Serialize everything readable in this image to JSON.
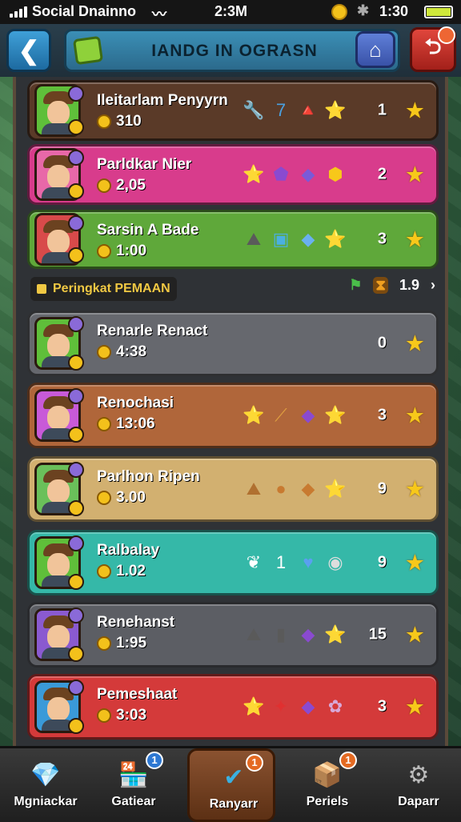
{
  "status_bar": {
    "carrier": "Social Dnainno",
    "time": "2:3M",
    "time_right": "1:30",
    "icons": [
      "signal-icon",
      "wifi-icon",
      "coin-icon",
      "bluetooth-icon",
      "battery-icon"
    ]
  },
  "header": {
    "title": "IANDG IN OGRASN",
    "back_icon": "back-chevron-icon",
    "title_icon": "gem-icon",
    "home_icon": "home-icon",
    "exit_icon": "exit-icon"
  },
  "top_rows": [
    {
      "name": "Ileitarlam Penyyrn",
      "score": "310",
      "rank": "1",
      "color": "#5a3a28",
      "avatar_bg": "#5fbf3a",
      "items": [
        "🔧",
        "7",
        "🔺",
        "⭐"
      ],
      "item_colors": [
        "#6a7a8a",
        "#4aa0e0",
        "#e23838",
        "#f7c81a"
      ]
    },
    {
      "name": "Parldkar Nier",
      "score": "2,05",
      "rank": "2",
      "color": "#d83c8c",
      "avatar_bg": "#e868a8",
      "items": [
        "⭐",
        "⬟",
        "◆",
        "⬢"
      ],
      "item_colors": [
        "#f7c81a",
        "#8a4ad0",
        "#7a5ad8",
        "#f7c81a"
      ]
    },
    {
      "name": "Sarsin A Bade",
      "score": "1:00",
      "rank": "3",
      "color": "#5fa83a",
      "avatar_bg": "#d84a4a",
      "items": [
        "⛰",
        "▣",
        "◆",
        "⭐"
      ],
      "item_colors": [
        "#5a5a5a",
        "#4ab0e0",
        "#6ab0f0",
        "#f7c81a"
      ]
    }
  ],
  "section": {
    "label": "Peringkat PEMAAN",
    "page": "1.9",
    "icons": [
      "flag-icon",
      "hourglass-icon",
      "chevron-right-icon"
    ]
  },
  "rows": [
    {
      "name": "Renarle Renact",
      "score": "4:38",
      "rank": "0",
      "color": "#66686e",
      "avatar_bg": "#5fbf3a",
      "items": [],
      "item_colors": []
    },
    {
      "name": "Renochasi",
      "score": "13:06",
      "rank": "3",
      "color": "#b0663a",
      "avatar_bg": "#c85ad8",
      "items": [
        "⭐",
        "⟋",
        "◆",
        "⭐"
      ],
      "item_colors": [
        "#f7c81a",
        "#e0a040",
        "#8a4ad0",
        "#f7c81a"
      ]
    },
    {
      "name": "Parlhon Ripen",
      "score": "3.00",
      "rank": "9",
      "color": "#d2b070",
      "avatar_bg": "#6ac05a",
      "items": [
        "⛰",
        "●",
        "◆",
        "⭐"
      ],
      "item_colors": [
        "#b07030",
        "#c87a30",
        "#c87a30",
        "#f7c81a"
      ]
    },
    {
      "name": "Ralbalay",
      "score": "1.02",
      "rank": "9",
      "color": "#35b8a8",
      "avatar_bg": "#5fbf3a",
      "items": [
        "❦",
        "1",
        "♥",
        "◉"
      ],
      "item_colors": [
        "#ffffff",
        "#ffffff",
        "#5aa0f0",
        "#dddddd"
      ]
    },
    {
      "name": "Renehanst",
      "score": "1:95",
      "rank": "15",
      "color": "#5c5e64",
      "avatar_bg": "#8a5ad0",
      "items": [
        "⛰",
        "▮",
        "◆",
        "⭐"
      ],
      "item_colors": [
        "#5a5a5a",
        "#5a5a5a",
        "#8a4ad0",
        "#f7c81a"
      ]
    },
    {
      "name": "Pemeshaat",
      "score": "3:03",
      "rank": "3",
      "color": "#d43a3a",
      "avatar_bg": "#3a9ad8",
      "items": [
        "⭐",
        "✦",
        "◆",
        "✿"
      ],
      "item_colors": [
        "#f7c81a",
        "#e03030",
        "#8a4ad0",
        "#d8a8d8"
      ]
    }
  ],
  "bottom_nav": [
    {
      "label": "Mgniackar",
      "icon": "crystal-icon",
      "glyph": "💎",
      "badge": ""
    },
    {
      "label": "Gatiear",
      "icon": "shop-icon",
      "glyph": "🏪",
      "badge": "1"
    },
    {
      "label": "Ranyarr",
      "icon": "check-orb-icon",
      "glyph": "✔",
      "badge": "1"
    },
    {
      "label": "Periels",
      "icon": "box-icon",
      "glyph": "📦",
      "badge": "1"
    },
    {
      "label": "Daparr",
      "icon": "gear-icon",
      "glyph": "⚙",
      "badge": ""
    }
  ]
}
